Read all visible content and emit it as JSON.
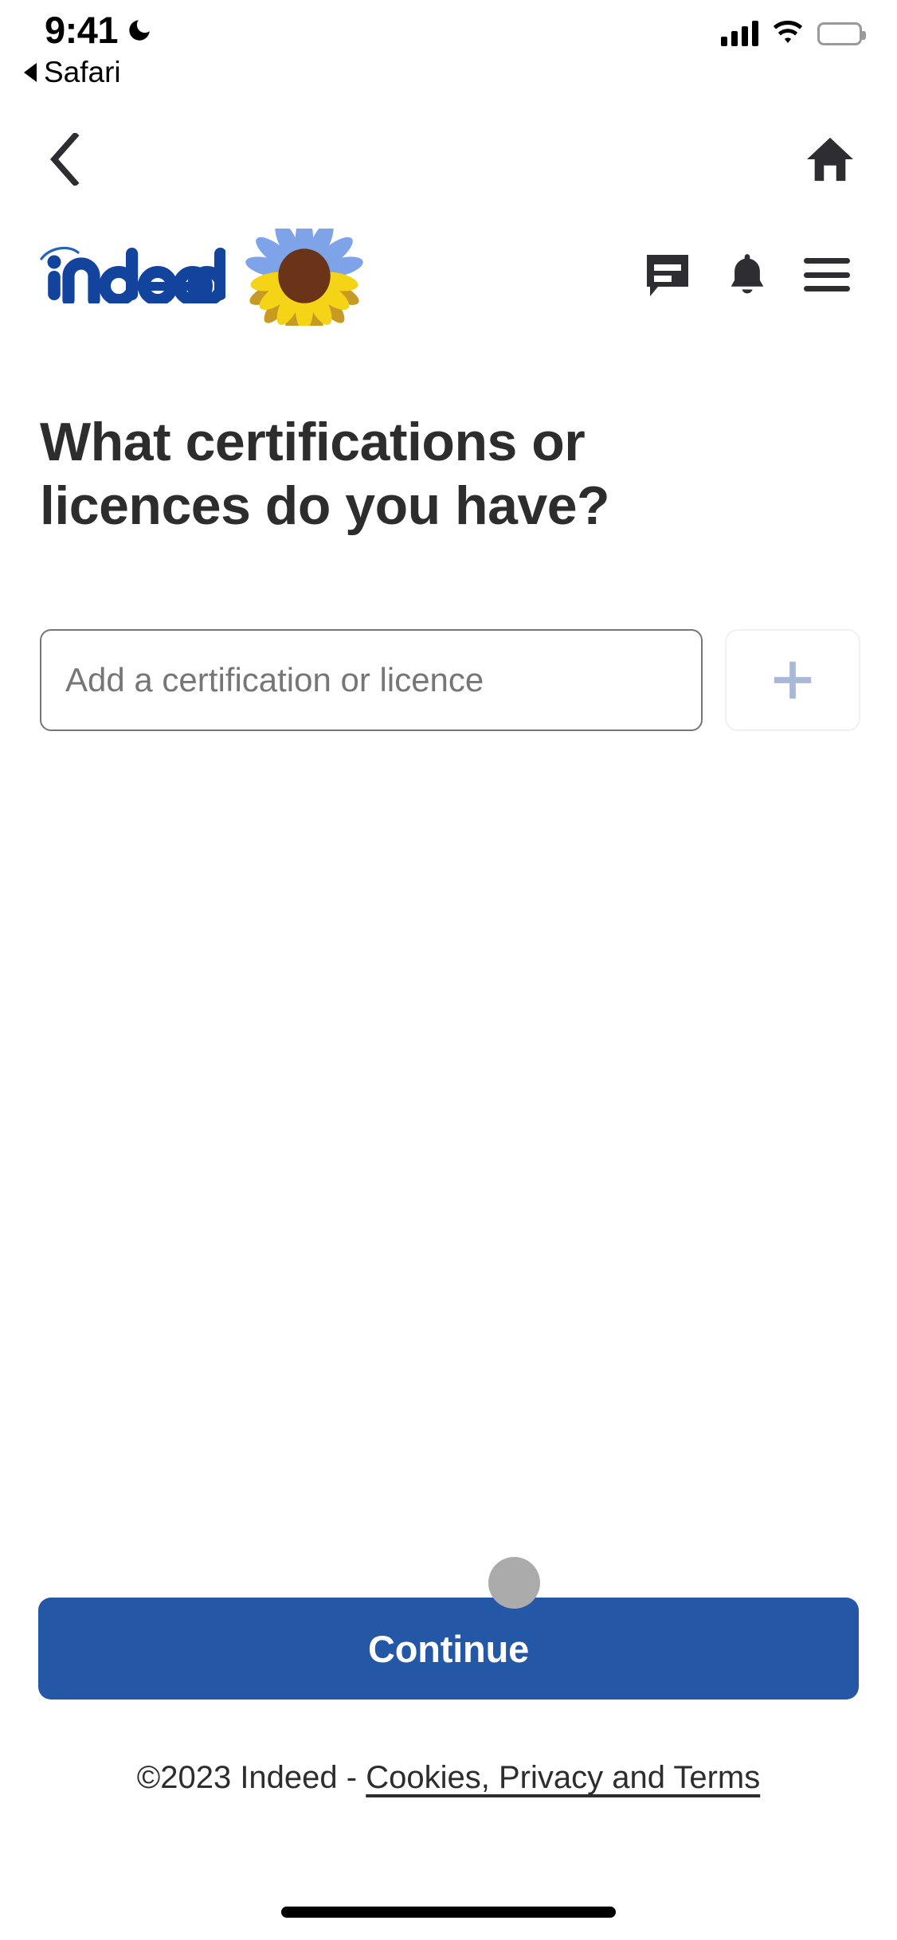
{
  "status_bar": {
    "time": "9:41",
    "dnd_icon": "moon-icon",
    "return_label": "Safari",
    "signal_icon": "cellular-signal-icon",
    "wifi_icon": "wifi-icon",
    "battery_icon": "battery-full-icon"
  },
  "browser_nav": {
    "back_icon": "chevron-left-icon",
    "home_icon": "home-icon"
  },
  "site_header": {
    "logo_text": "indeed",
    "logo_icon": "indeed-logo",
    "sunflower_icon": "sunflower-icon",
    "messages_icon": "message-bubble-icon",
    "notifications_icon": "bell-icon",
    "menu_icon": "hamburger-menu-icon",
    "brand_color": "#2164bf"
  },
  "main": {
    "title": "What certifications or licences do you have?",
    "certification_input": {
      "value": "",
      "placeholder": "Add a certification or licence"
    },
    "add_button": {
      "icon": "plus-icon",
      "label": "+"
    }
  },
  "footer": {
    "continue_label": "Continue",
    "continue_color": "#2557a7",
    "copyright": "©2023 Indeed -",
    "legal_link": "Cookies, Privacy and Terms"
  }
}
